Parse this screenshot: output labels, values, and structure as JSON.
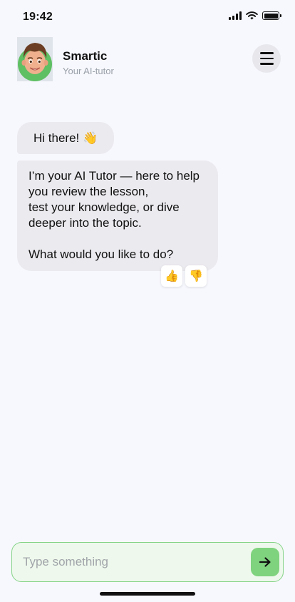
{
  "status_bar": {
    "time": "19:42"
  },
  "header": {
    "name": "Smartic",
    "subtitle": "Your AI-tutor"
  },
  "messages": [
    {
      "text": "Hi there! 👋"
    },
    {
      "text": "I’m your AI Tutor — here to help\nyou review the lesson,\ntest your knowledge, or dive\ndeeper into the topic.\n\nWhat would you like to do?"
    }
  ],
  "reactions": {
    "like": "👍",
    "dislike": "👎"
  },
  "composer": {
    "placeholder": "Type something",
    "value": ""
  },
  "colors": {
    "background": "#f7f8fe",
    "bubble": "#ebeaef",
    "accent": "#7fd27e",
    "composer_border": "#86d488"
  }
}
